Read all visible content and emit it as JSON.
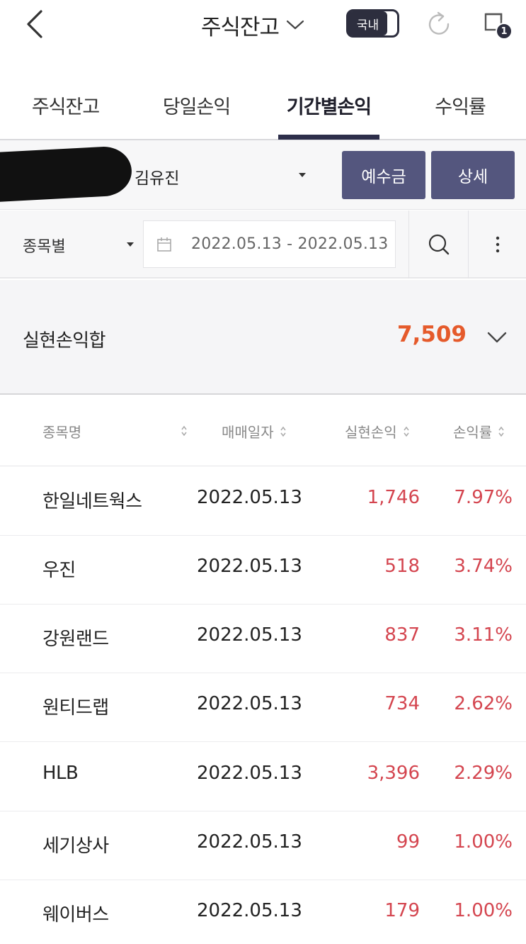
{
  "header": {
    "title": "주식잔고",
    "market_toggle": "국내",
    "notification_count": "1"
  },
  "tabs": [
    {
      "label": "주식잔고",
      "active": false
    },
    {
      "label": "당일손익",
      "active": false
    },
    {
      "label": "기간별손익",
      "active": true
    },
    {
      "label": "수익률",
      "active": false
    }
  ],
  "account": {
    "name": "김유진",
    "deposit_button": "예수금",
    "detail_button": "상세"
  },
  "filter": {
    "type": "종목별",
    "date_range": "2022.05.13 - 2022.05.13"
  },
  "summary": {
    "label": "실현손익합",
    "value": "7,509"
  },
  "table": {
    "headers": {
      "name": "종목명",
      "date": "매매일자",
      "pnl": "실현손익",
      "rate": "손익률"
    },
    "rows": [
      {
        "name": "한일네트웍스",
        "date": "2022.05.13",
        "pnl": "1,746",
        "rate": "7.97%"
      },
      {
        "name": "우진",
        "date": "2022.05.13",
        "pnl": "518",
        "rate": "3.74%"
      },
      {
        "name": "강원랜드",
        "date": "2022.05.13",
        "pnl": "837",
        "rate": "3.11%"
      },
      {
        "name": "원티드랩",
        "date": "2022.05.13",
        "pnl": "734",
        "rate": "2.62%"
      },
      {
        "name": "HLB",
        "date": "2022.05.13",
        "pnl": "3,396",
        "rate": "2.29%"
      },
      {
        "name": "세기상사",
        "date": "2022.05.13",
        "pnl": "99",
        "rate": "1.00%"
      },
      {
        "name": "웨이버스",
        "date": "2022.05.13",
        "pnl": "179",
        "rate": "1.00%"
      }
    ]
  },
  "colors": {
    "accent_dark": "#2d2e3e",
    "button_bg": "#54567e",
    "profit_red": "#d4454f",
    "summary_orange": "#e55a2b"
  }
}
